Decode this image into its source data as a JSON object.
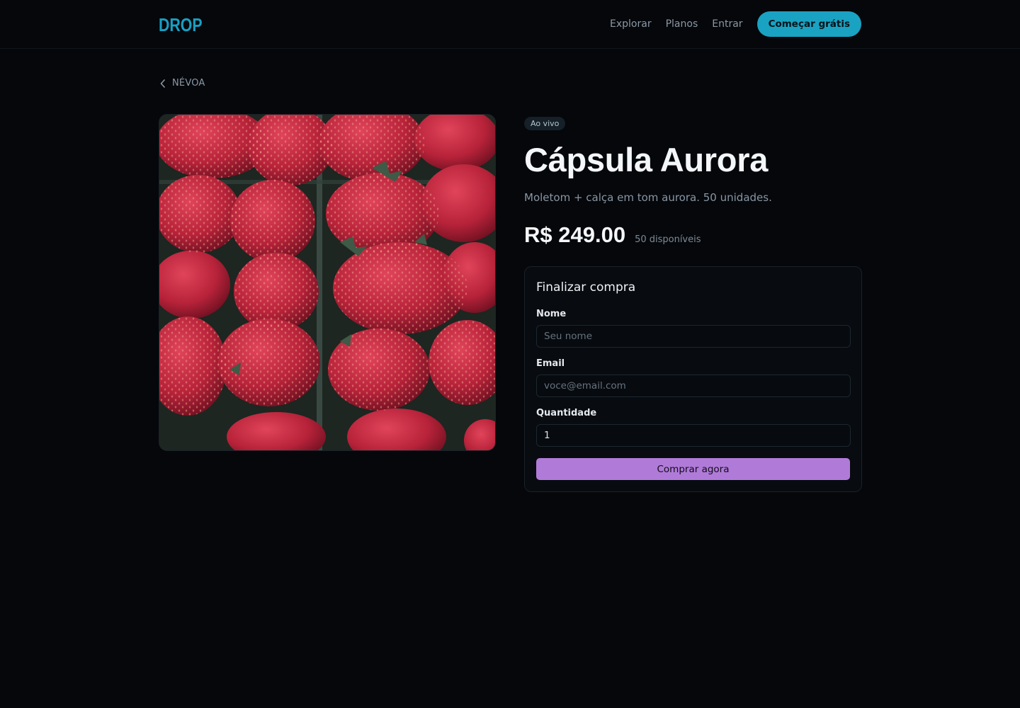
{
  "header": {
    "logo": "DROP",
    "nav": [
      "Explorar",
      "Planos",
      "Entrar"
    ],
    "cta": "Começar grátis"
  },
  "breadcrumb": {
    "label": "NÉVOA",
    "icon": "chevron-left-icon"
  },
  "product": {
    "image": "strawberries-photo",
    "badge": "Ao vivo",
    "title": "Cápsula Aurora",
    "description": "Moletom + calça em tom aurora. 50 unidades.",
    "price": "R$ 249.00",
    "stock": "50 disponíveis"
  },
  "checkout": {
    "title": "Finalizar compra",
    "name_label": "Nome",
    "name_placeholder": "Seu nome",
    "email_label": "Email",
    "email_placeholder": "voce@email.com",
    "quantity_label": "Quantidade",
    "quantity_value": "1",
    "submit": "Comprar agora"
  },
  "colors": {
    "accent": "#1aa2c2",
    "buy_button": "#b07bd8",
    "background": "#05070b"
  }
}
